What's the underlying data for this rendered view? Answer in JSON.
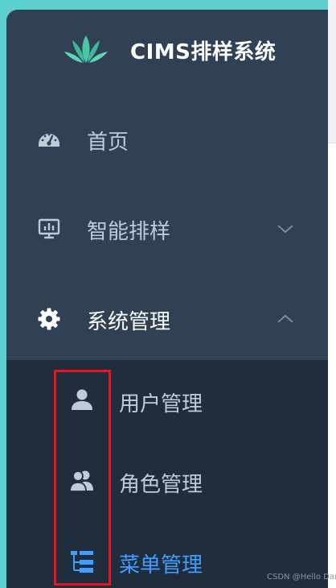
{
  "app": {
    "title": "CIMS排样系统",
    "logo_icon": "grass-logo-icon"
  },
  "menu": [
    {
      "label": "首页",
      "icon": "dashboard-icon"
    },
    {
      "label": "智能排样",
      "icon": "monitor-chart-icon",
      "expanded": false
    },
    {
      "label": "系统管理",
      "icon": "gear-icon",
      "expanded": true
    }
  ],
  "submenu": [
    {
      "label": "用户管理",
      "icon": "user-icon",
      "active": false
    },
    {
      "label": "角色管理",
      "icon": "users-icon",
      "active": false
    },
    {
      "label": "菜单管理",
      "icon": "tree-table-icon",
      "active": true
    }
  ],
  "watermark": "CSDN @Hello Dam",
  "colors": {
    "sidebar_bg": "#304156",
    "submenu_bg": "#1f2d3d",
    "text": "#bfcbd9",
    "active_text": "#409eff",
    "logo_green": "#4dc6a6",
    "annotation_red": "#e8161b",
    "page_bg": "#5ccfcf"
  }
}
